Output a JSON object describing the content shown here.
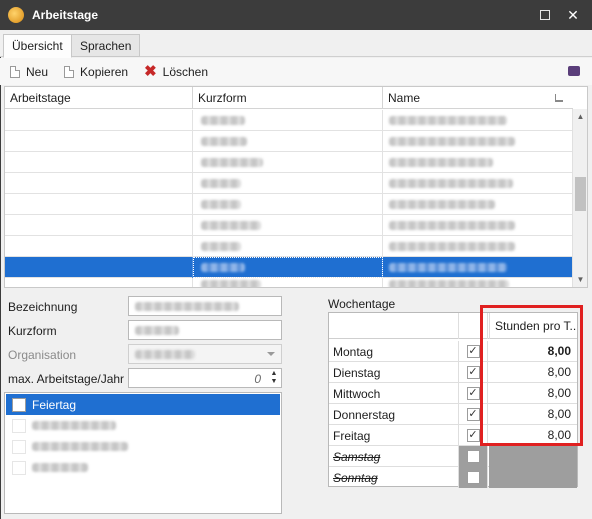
{
  "window": {
    "title": "Arbeitstage",
    "close_glyph": "✕"
  },
  "tabs": [
    {
      "label": "Übersicht",
      "active": true
    },
    {
      "label": "Sprachen",
      "active": false
    }
  ],
  "toolbar": {
    "new_label": "Neu",
    "copy_label": "Kopieren",
    "delete_label": "Löschen",
    "delete_color": "#c62828"
  },
  "grid": {
    "columns": [
      "Arbeitstage",
      "Kurzform",
      "Name"
    ],
    "row_count_visible": 8,
    "selected_row_index": 7,
    "selection_color": "#1f6fd1"
  },
  "form": {
    "bezeichnung_label": "Bezeichnung",
    "kurzform_label": "Kurzform",
    "organisation_label": "Organisation",
    "max_days_label": "max. Arbeitstage/Jahr",
    "max_days_value": "0"
  },
  "list": {
    "items": [
      {
        "label": "Feiertag",
        "selected": true
      }
    ]
  },
  "week": {
    "label": "Wochentage",
    "hours_header": "Stunden pro T...",
    "days": [
      {
        "day": "Montag",
        "checked": true,
        "hours": "8,00",
        "bold": true,
        "disabled": false
      },
      {
        "day": "Dienstag",
        "checked": true,
        "hours": "8,00",
        "bold": false,
        "disabled": false
      },
      {
        "day": "Mittwoch",
        "checked": true,
        "hours": "8,00",
        "bold": false,
        "disabled": false
      },
      {
        "day": "Donnerstag",
        "checked": true,
        "hours": "8,00",
        "bold": false,
        "disabled": false
      },
      {
        "day": "Freitag",
        "checked": true,
        "hours": "8,00",
        "bold": false,
        "disabled": false
      },
      {
        "day": "Samstag",
        "checked": false,
        "hours": "",
        "bold": false,
        "disabled": true
      },
      {
        "day": "Sonntag",
        "checked": false,
        "hours": "",
        "bold": false,
        "disabled": true
      }
    ],
    "highlight_color": "#e02020"
  }
}
